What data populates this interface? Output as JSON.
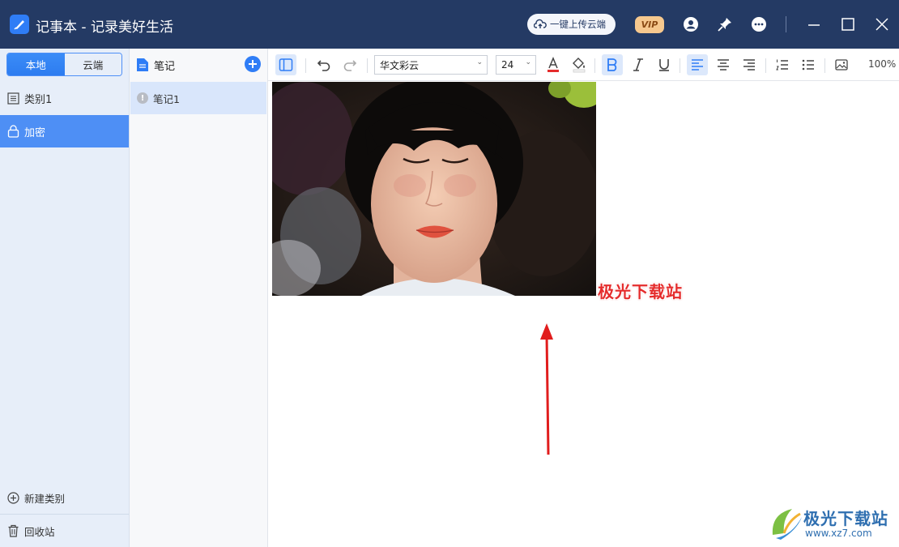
{
  "titlebar": {
    "title": "记事本 - 记录美好生活",
    "upload_label": "一键上传云端",
    "vip_label": "VIP"
  },
  "sidebar": {
    "tabs": [
      {
        "label": "本地",
        "active": true
      },
      {
        "label": "云端",
        "active": false
      }
    ],
    "items": [
      {
        "label": "类别1",
        "icon": "list-icon",
        "selected": false
      },
      {
        "label": "加密",
        "icon": "lock-icon",
        "selected": true
      }
    ],
    "new_category_label": "新建类别",
    "recycle_label": "回收站"
  },
  "notelist": {
    "title": "笔记",
    "notes": [
      {
        "label": "笔记1",
        "selected": true
      }
    ]
  },
  "toolbar": {
    "font_family": "华文彩云",
    "font_size": "24",
    "zoom": "100%"
  },
  "editor": {
    "overlay_text": "极光下载站"
  },
  "watermark": {
    "text": "极光下载站",
    "url": "www.xz7.com"
  },
  "colors": {
    "titlebar": "#243a64",
    "accent": "#2f7df6",
    "sidebar_selected": "#4e8ff5",
    "overlay_text": "#e52c2c",
    "arrow": "#e11d1d"
  }
}
